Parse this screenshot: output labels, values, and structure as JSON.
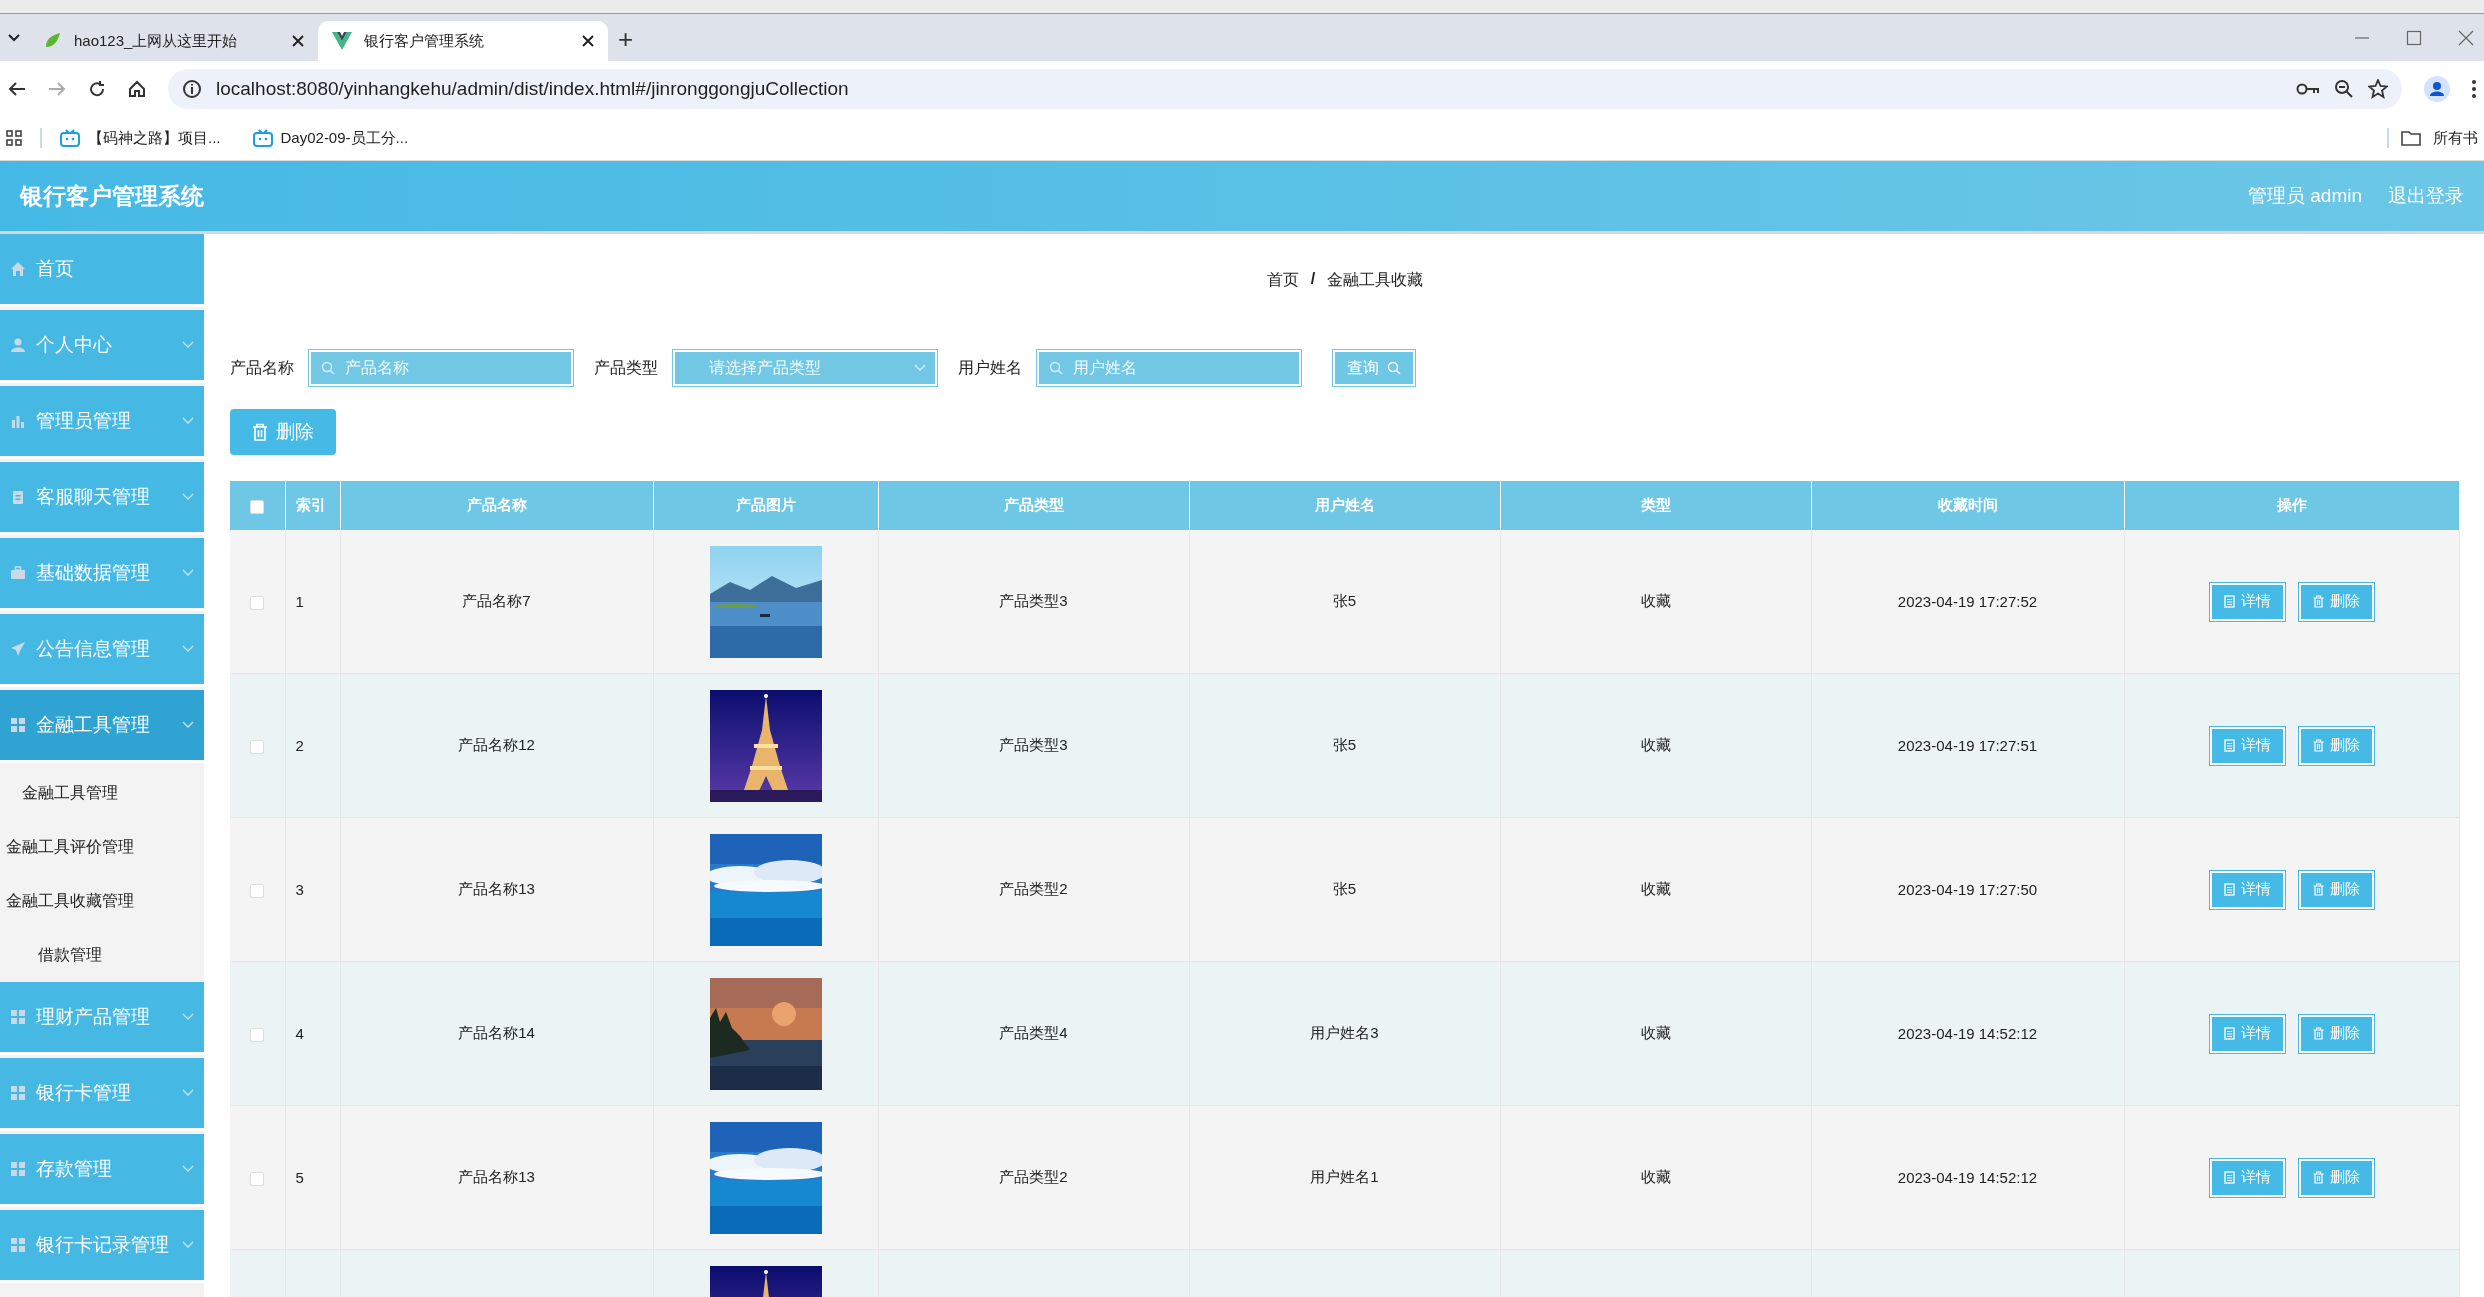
{
  "browser": {
    "tabs": [
      {
        "title": "hao123_上网从这里开始",
        "selected": false
      },
      {
        "title": "银行客户管理系统",
        "selected": true
      }
    ],
    "new_tab": "+",
    "url": "localhost:8080/yinhangkehu/admin/dist/index.html#/jinronggongjuCollection",
    "bookmarks": [
      "【码神之路】项目...",
      "Day02-09-员工分..."
    ],
    "all_bookmarks": "所有书"
  },
  "header": {
    "title": "银行客户管理系统",
    "user": "管理员 admin",
    "logout": "退出登录"
  },
  "sidebar": {
    "items": [
      {
        "label": "首页",
        "kind": "link"
      },
      {
        "label": "个人中心",
        "kind": "submenu",
        "expanded": false
      },
      {
        "label": "管理员管理",
        "kind": "submenu",
        "expanded": false
      },
      {
        "label": "客服聊天管理",
        "kind": "submenu",
        "expanded": false
      },
      {
        "label": "基础数据管理",
        "kind": "submenu",
        "expanded": false
      },
      {
        "label": "公告信息管理",
        "kind": "submenu",
        "expanded": false
      },
      {
        "label": "金融工具管理",
        "kind": "submenu",
        "expanded": true,
        "children": [
          "金融工具管理",
          "金融工具评价管理",
          "金融工具收藏管理",
          "借款管理"
        ]
      },
      {
        "label": "理财产品管理",
        "kind": "submenu",
        "expanded": false
      },
      {
        "label": "银行卡管理",
        "kind": "submenu",
        "expanded": false
      },
      {
        "label": "存款管理",
        "kind": "submenu",
        "expanded": false
      },
      {
        "label": "银行卡记录管理",
        "kind": "submenu",
        "expanded": false
      }
    ]
  },
  "breadcrumb": {
    "items": [
      "首页",
      "金融工具收藏"
    ],
    "separator": "/"
  },
  "filters": [
    {
      "label": "产品名称",
      "placeholder": "产品名称",
      "kind": "search"
    },
    {
      "label": "产品类型",
      "placeholder": "请选择产品类型",
      "kind": "select"
    },
    {
      "label": "用户姓名",
      "placeholder": "用户姓名",
      "kind": "search"
    }
  ],
  "query_button": "查询",
  "delete_button": "删除",
  "table": {
    "header_checked": false,
    "columns": [
      "索引",
      "产品名称",
      "产品图片",
      "产品类型",
      "用户姓名",
      "类型",
      "收藏时间",
      "操作"
    ],
    "rows": [
      {
        "checked": false,
        "index": "1",
        "name": "产品名称7",
        "image": {
          "kind": "picture"
        },
        "type": "产品类型3",
        "user": "张5",
        "category": "收藏",
        "time": "2023-04-19 17:27:52",
        "actions": [
          "详情",
          "删除"
        ]
      },
      {
        "checked": false,
        "index": "2",
        "name": "产品名称12",
        "image": {
          "kind": "picture"
        },
        "type": "产品类型3",
        "user": "张5",
        "category": "收藏",
        "time": "2023-04-19 17:27:51",
        "actions": [
          "详情",
          "删除"
        ]
      },
      {
        "checked": false,
        "index": "3",
        "name": "产品名称13",
        "image": {
          "kind": "picture"
        },
        "type": "产品类型2",
        "user": "张5",
        "category": "收藏",
        "time": "2023-04-19 17:27:50",
        "actions": [
          "详情",
          "删除"
        ]
      },
      {
        "checked": false,
        "index": "4",
        "name": "产品名称14",
        "image": {
          "kind": "picture"
        },
        "type": "产品类型4",
        "user": "用户姓名3",
        "category": "收藏",
        "time": "2023-04-19 14:52:12",
        "actions": [
          "详情",
          "删除"
        ]
      },
      {
        "checked": false,
        "index": "5",
        "name": "产品名称13",
        "image": {
          "kind": "picture"
        },
        "type": "产品类型2",
        "user": "用户姓名1",
        "category": "收藏",
        "time": "2023-04-19 14:52:12",
        "actions": [
          "详情",
          "删除"
        ]
      },
      {
        "image": {
          "kind": "picture"
        }
      }
    ]
  }
}
